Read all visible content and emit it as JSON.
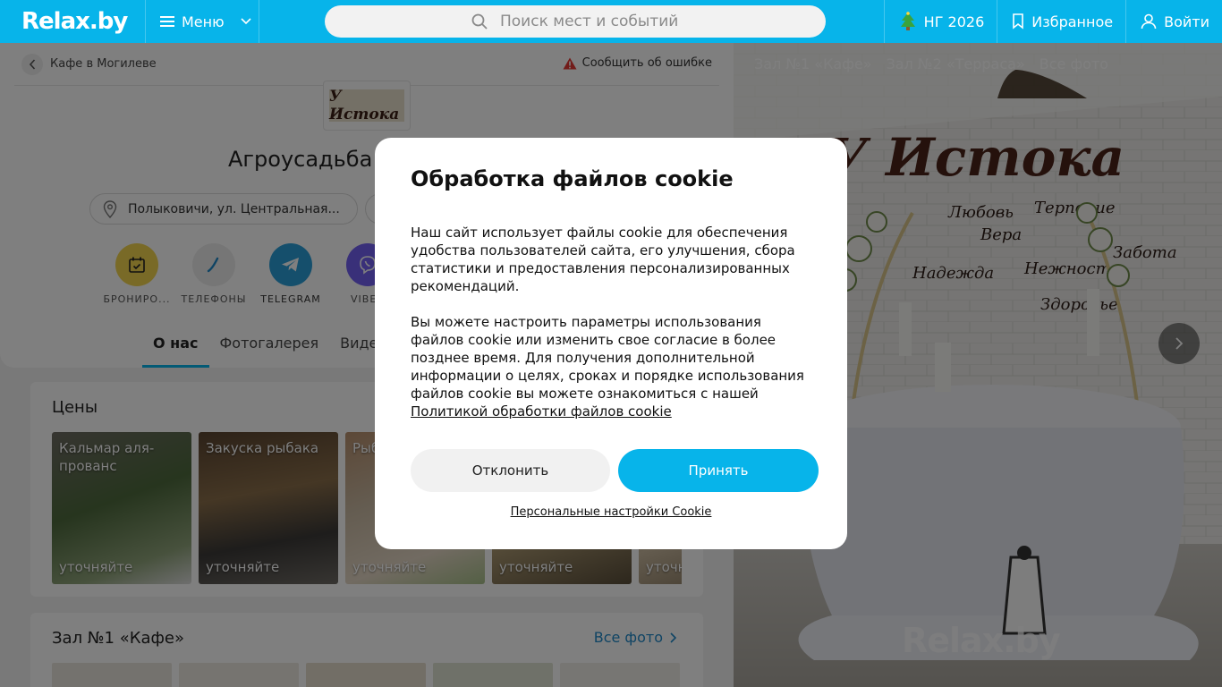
{
  "header": {
    "logo": "Relax.by",
    "menu_label": "Меню",
    "search_placeholder": "Поиск мест и событий",
    "ny_label": "НГ 2026",
    "favorites_label": "Избранное",
    "login_label": "Войти"
  },
  "colors": {
    "brand": "#07b4ea",
    "booking": "#f2d44e",
    "telegram": "#2a9fd9",
    "viber": "#7360f2",
    "link": "#1e88c8"
  },
  "place": {
    "breadcrumb": "Кафе в Могилеве",
    "report": "Сообщить об ошибке",
    "logo_text": "У Истока",
    "title": "Агроусадьба",
    "address": "Полыковичи, ул. Центральная..."
  },
  "actions": [
    {
      "label": "БРОНИРО...",
      "icon": "calendar-icon"
    },
    {
      "label": "ТЕЛЕФОНЫ",
      "icon": "phone-icon"
    },
    {
      "label": "TELEGRAM",
      "icon": "telegram-icon"
    },
    {
      "label": "VIBER",
      "icon": "viber-icon"
    }
  ],
  "tabs": [
    {
      "label": "О нас"
    },
    {
      "label": "Фотогалерея"
    },
    {
      "label": "Видео"
    }
  ],
  "prices": {
    "title": "Цены",
    "items": [
      {
        "name": "Кальмар аля-прованс",
        "price": "уточняйте"
      },
      {
        "name": "Закуска рыбака",
        "price": "уточняйте"
      },
      {
        "name": "Рыб",
        "price": "уточняйте"
      },
      {
        "name": "",
        "price": "уточняйте"
      },
      {
        "name": "",
        "price": "уточн"
      }
    ]
  },
  "hall": {
    "title": "Зал №1 «Кафе»",
    "all_photos": "Все фото"
  },
  "gallery": {
    "tabs": [
      "Зал №1 «Кафе»",
      "Зал №2 «Терраса»",
      "Все фото"
    ],
    "sign_text": "У Истока",
    "wall_words": [
      "Любовь",
      "Вера",
      "Надежда",
      "Нежность",
      "Здоровье",
      "Терпение",
      "Забота"
    ],
    "watermark": "Relax.by"
  },
  "cookie": {
    "title": "Обработка файлов cookie",
    "p1": "Наш сайт использует файлы cookie для обеспечения удобства пользователей сайта, его улучшения, сбора статистики и предоставления персонализированных рекомендаций.",
    "p2": "Вы можете настроить параметры использования файлов cookie или изменить свое согласие в более позднее время. Для получения дополнительной информации о целях, сроках и порядке использования файлов cookie вы можете ознакомиться с нашей",
    "policy_link": "Политикой обработки файлов cookie",
    "decline": "Отклонить",
    "accept": "Принять",
    "settings": "Персональные настройки Cookie"
  }
}
